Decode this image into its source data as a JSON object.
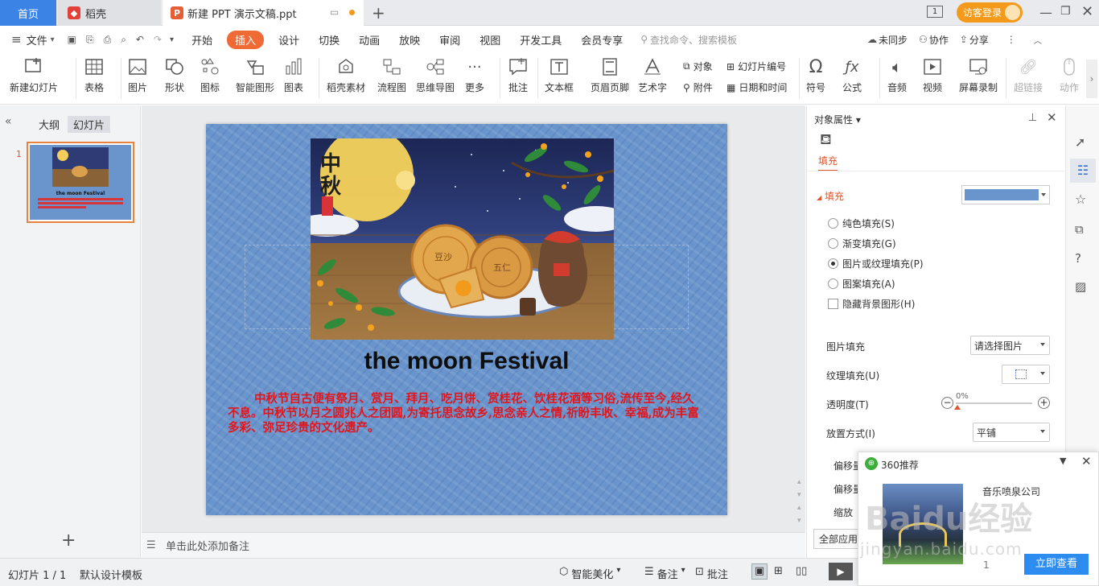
{
  "tabs": {
    "home": "首页",
    "daoke": "稻壳",
    "doc": "新建 PPT 演示文稿.ppt"
  },
  "topright": {
    "badge": "1",
    "login": "访客登录"
  },
  "menu": {
    "file": "文件",
    "items": [
      "开始",
      "插入",
      "设计",
      "切换",
      "动画",
      "放映",
      "审阅",
      "视图",
      "开发工具",
      "会员专享"
    ],
    "active": "插入",
    "search": "查找命令、搜索模板",
    "sync": "未同步",
    "collab": "协作",
    "share": "分享"
  },
  "ribbon": {
    "new_slide": "新建幻灯片",
    "table": "表格",
    "picture": "图片",
    "shape": "形状",
    "icon": "图标",
    "smart_shape": "智能图形",
    "chart": "图表",
    "daoke_material": "稻壳素材",
    "flowchart": "流程图",
    "mindmap": "思维导图",
    "more": "更多",
    "comment": "批注",
    "textbox": "文本框",
    "header_footer": "页眉页脚",
    "wordart": "艺术字",
    "object": "对象",
    "slide_number": "幻灯片编号",
    "attachment": "附件",
    "datetime": "日期和时间",
    "symbol": "符号",
    "formula": "公式",
    "audio": "音频",
    "video": "视频",
    "screen_record": "屏幕录制",
    "hyperlink": "超链接",
    "action": "动作"
  },
  "leftpane": {
    "outline": "大纲",
    "slides": "幻灯片",
    "slide_num": "1"
  },
  "slide": {
    "moon_chars": "中秋",
    "cake1": "豆沙",
    "cake2": "五仁",
    "title": "the moon Festival",
    "body": "中秋节自古便有祭月、赏月、拜月、吃月饼、赏桂花、饮桂花酒等习俗,流传至今,经久不息。中秋节以月之圆兆人之团圆,为寄托思念故乡,思念亲人之情,祈盼丰收、幸福,成为丰富多彩、弥足珍贵的文化遗产。",
    "thumb_title": "the moon Festival"
  },
  "notes": "单击此处添加备注",
  "rightpane": {
    "header": "对象属性",
    "tab": "填充",
    "section": "填充",
    "options": [
      "纯色填充(S)",
      "渐变填充(G)",
      "图片或纹理填充(P)",
      "图案填充(A)"
    ],
    "selected_option": "图片或纹理填充(P)",
    "hide_bg": "隐藏背景图形(H)",
    "picture_fill": "图片填充",
    "picture_fill_value": "请选择图片",
    "texture_fill": "纹理填充(U)",
    "transparency": "透明度(T)",
    "transparency_value": "0%",
    "placement": "放置方式(I)",
    "placement_value": "平铺",
    "offset1": "偏移量",
    "offset2": "偏移量",
    "scale": "缩放",
    "apply_all": "全部应用",
    "fill_color": "#6a95cc"
  },
  "popup": {
    "title": "360推荐",
    "company": "音乐喷泉公司",
    "page": "1",
    "button": "立即查看",
    "watermark": "Baidu经验",
    "watermark_url": "jingyan.baidu.com"
  },
  "status": {
    "slide_count": "幻灯片 1 / 1",
    "template": "默认设计模板",
    "beautify": "智能美化",
    "notes": "备注",
    "comment": "批注"
  },
  "colors": {
    "accent": "#f06a36",
    "home_tab": "#3c83e6",
    "body_text": "#e4141b"
  }
}
